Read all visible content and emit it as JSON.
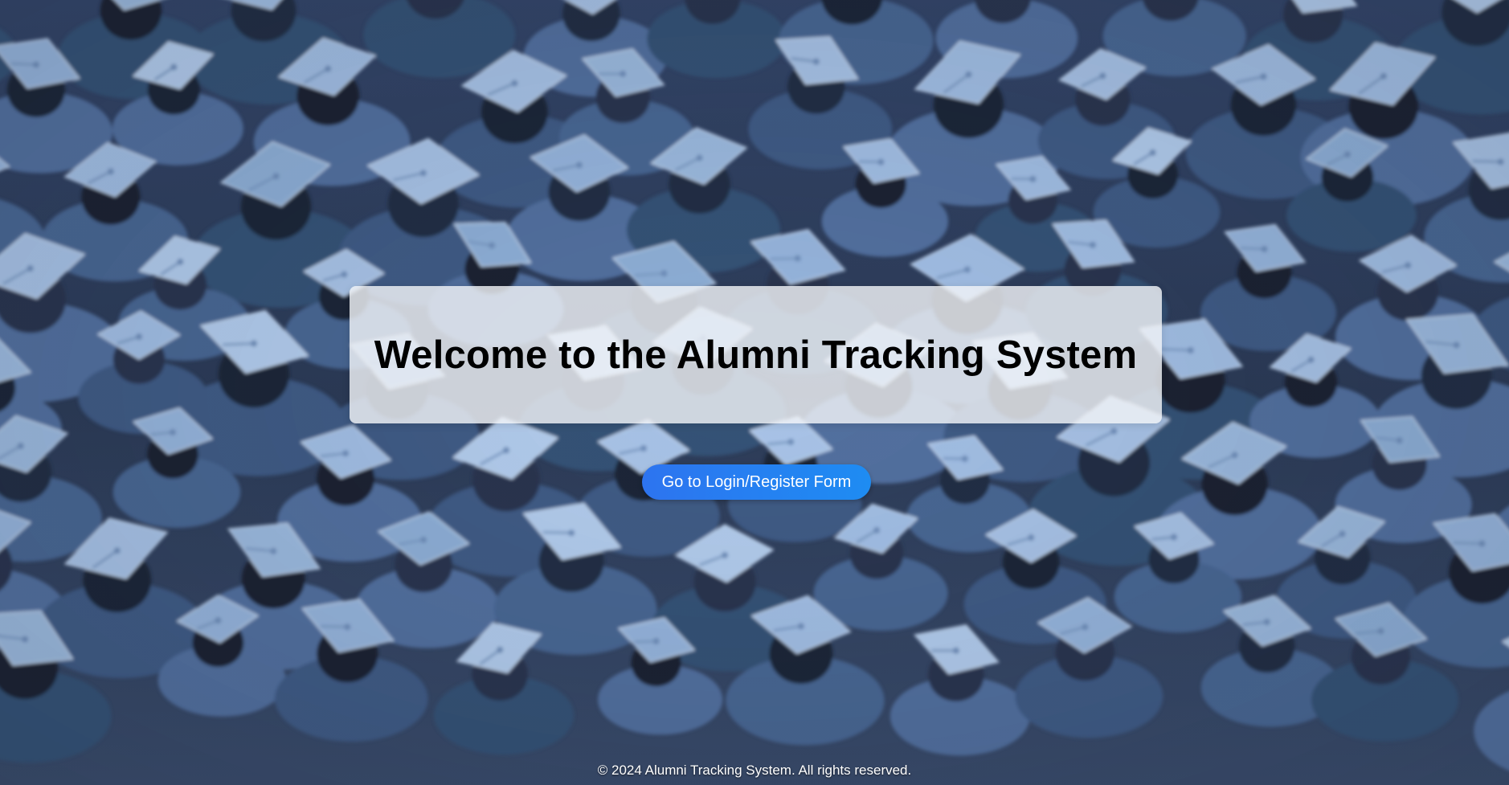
{
  "welcome": {
    "title": "Welcome to the Alumni Tracking System"
  },
  "actions": {
    "login_register_label": "Go to Login/Register Form"
  },
  "footer": {
    "copyright": "© 2024 Alumni Tracking System. All rights reserved."
  },
  "theme": {
    "button_color": "#2d74f0",
    "panel_color": "#f0f3f7",
    "cap_color": "#9dbbe0",
    "background_dark": "#2a3a52"
  }
}
